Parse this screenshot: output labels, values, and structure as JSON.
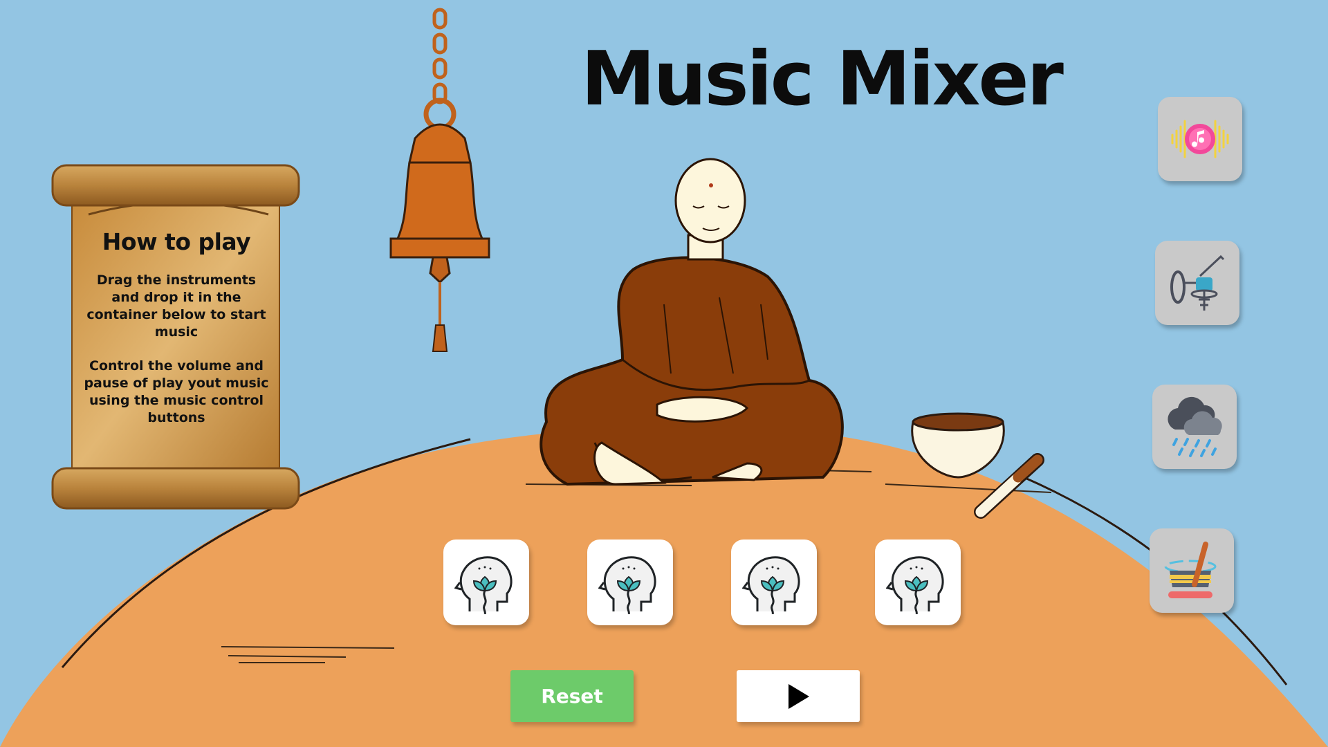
{
  "title": "Music Mixer",
  "how_to_play": {
    "heading": "How to play",
    "paragraph_1": "Drag the instruments and drop it in the container below to start music",
    "paragraph_2": "Control the volume and pause of play yout music using the music control buttons"
  },
  "instruments": [
    {
      "icon": "music-wave-icon"
    },
    {
      "icon": "microphone-stand-icon"
    },
    {
      "icon": "rain-cloud-icon"
    },
    {
      "icon": "singing-bowl-icon"
    }
  ],
  "drop_slots": [
    {
      "icon": "meditation-head-icon"
    },
    {
      "icon": "meditation-head-icon"
    },
    {
      "icon": "meditation-head-icon"
    },
    {
      "icon": "meditation-head-icon"
    }
  ],
  "controls": {
    "reset_label": "Reset",
    "play_icon": "play-icon"
  },
  "colors": {
    "sky": "#93c5e3",
    "hill": "#eda15a",
    "robe": "#8a3d0a",
    "bell": "#d06a1c",
    "reset": "#6dcb6a"
  }
}
